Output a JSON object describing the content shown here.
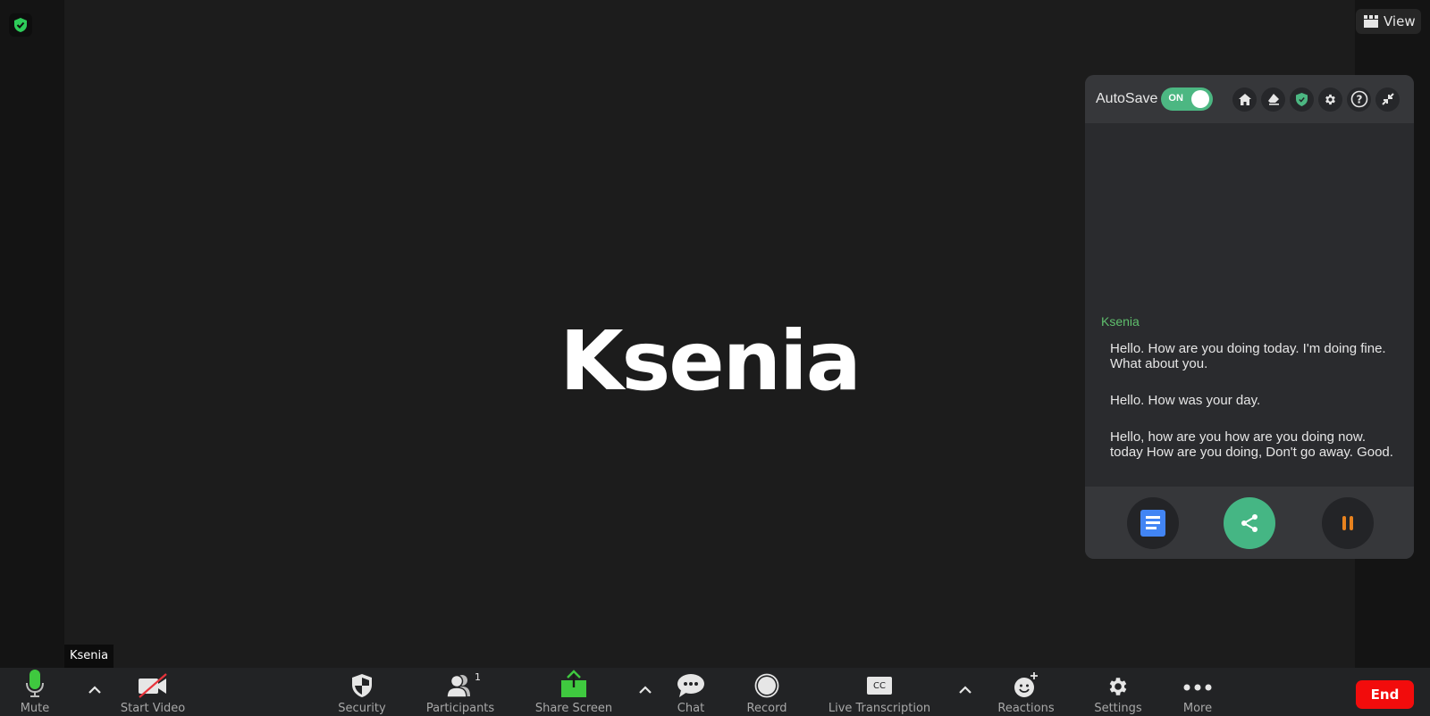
{
  "meeting": {
    "participant_name_large": "Ksenia",
    "name_tag": "Ksenia",
    "view_button_label": "View"
  },
  "panel": {
    "autosave_label": "AutoSave",
    "autosave_toggle": {
      "state": "ON"
    },
    "header_icons": [
      "home-icon",
      "eraser-icon",
      "shield-icon",
      "gear-icon",
      "help-icon",
      "minimize-icon"
    ],
    "transcript": {
      "speaker": "Ksenia",
      "lines": [
        "Hello. How are you doing today. I'm doing fine. What about you.",
        "Hello. How was your day.",
        "Hello, how are you how are you doing now. today How are you doing, Don't go away. Good."
      ]
    },
    "footer_buttons": [
      "document-icon",
      "share-icon",
      "pause-icon"
    ]
  },
  "toolbar": {
    "mute_label": "Mute",
    "start_video_label": "Start Video",
    "security_label": "Security",
    "participants_label": "Participants",
    "participants_count": "1",
    "share_screen_label": "Share Screen",
    "chat_label": "Chat",
    "record_label": "Record",
    "live_transcription_label": "Live Transcription",
    "cc_text": "CC",
    "reactions_label": "Reactions",
    "settings_label": "Settings",
    "more_label": "More",
    "end_label": "End"
  },
  "colors": {
    "accent_green": "#4cb782",
    "mic_green": "#3fc93f",
    "end_red": "#f20c0c",
    "speaker_green": "#5fbf6d",
    "pause_orange": "#e8821e",
    "doc_blue": "#4285f4"
  }
}
